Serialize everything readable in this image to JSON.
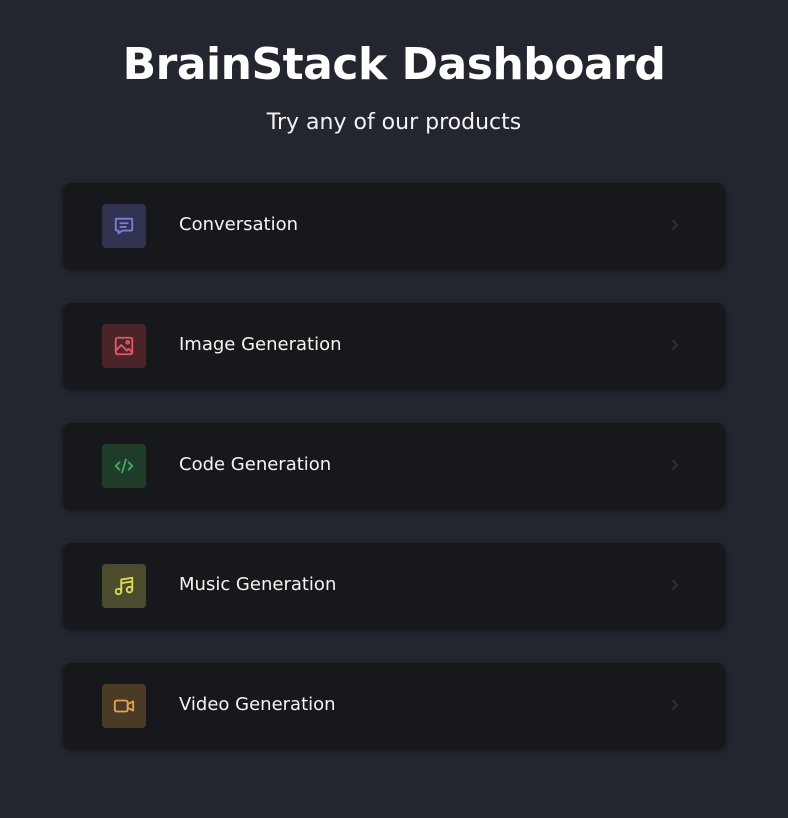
{
  "header": {
    "title": "BrainStack Dashboard",
    "subtitle": "Try any of our products"
  },
  "products": [
    {
      "label": "Conversation",
      "icon": "message-square-icon",
      "color": "#7c7fd6",
      "bg": "#30324f"
    },
    {
      "label": "Image Generation",
      "icon": "image-icon",
      "color": "#e05a63",
      "bg": "#4a2428"
    },
    {
      "label": "Code Generation",
      "icon": "code-icon",
      "color": "#3fae5c",
      "bg": "#1f3d2a"
    },
    {
      "label": "Music Generation",
      "icon": "music-icon",
      "color": "#dedd55",
      "bg": "#4b4c2d"
    },
    {
      "label": "Video Generation",
      "icon": "video-icon",
      "color": "#e4a44b",
      "bg": "#4a3a26"
    }
  ]
}
